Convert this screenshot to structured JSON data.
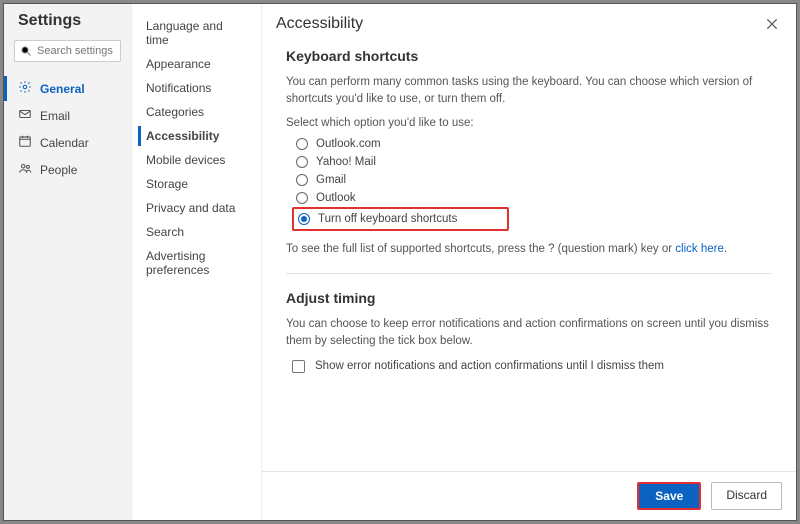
{
  "title": "Settings",
  "search": {
    "placeholder": "Search settings"
  },
  "nav1": [
    {
      "label": "General",
      "icon": "gear",
      "active": true
    },
    {
      "label": "Email",
      "icon": "mail",
      "active": false
    },
    {
      "label": "Calendar",
      "icon": "calendar",
      "active": false
    },
    {
      "label": "People",
      "icon": "people",
      "active": false
    }
  ],
  "nav2": [
    {
      "label": "Language and time",
      "active": false
    },
    {
      "label": "Appearance",
      "active": false
    },
    {
      "label": "Notifications",
      "active": false
    },
    {
      "label": "Categories",
      "active": false
    },
    {
      "label": "Accessibility",
      "active": true
    },
    {
      "label": "Mobile devices",
      "active": false
    },
    {
      "label": "Storage",
      "active": false
    },
    {
      "label": "Privacy and data",
      "active": false
    },
    {
      "label": "Search",
      "active": false
    },
    {
      "label": "Advertising preferences",
      "active": false
    }
  ],
  "main": {
    "heading": "Accessibility",
    "section1": {
      "title": "Keyboard shortcuts",
      "desc": "You can perform many common tasks using the keyboard. You can choose which version of shortcuts you'd like to use, or turn them off.",
      "select_label": "Select which option you'd like to use:",
      "options": [
        {
          "label": "Outlook.com",
          "checked": false
        },
        {
          "label": "Yahoo! Mail",
          "checked": false
        },
        {
          "label": "Gmail",
          "checked": false
        },
        {
          "label": "Outlook",
          "checked": false
        },
        {
          "label": "Turn off keyboard shortcuts",
          "checked": true,
          "highlighted": true
        }
      ],
      "help_prefix": "To see the full list of supported shortcuts, press the ? (question mark) key or ",
      "help_link": "click here",
      "help_suffix": "."
    },
    "section2": {
      "title": "Adjust timing",
      "desc": "You can choose to keep error notifications and action confirmations on screen until you dismiss them by selecting the tick box below.",
      "checkbox_label": "Show error notifications and action confirmations until I dismiss them",
      "checked": false
    }
  },
  "footer": {
    "save": "Save",
    "discard": "Discard"
  }
}
